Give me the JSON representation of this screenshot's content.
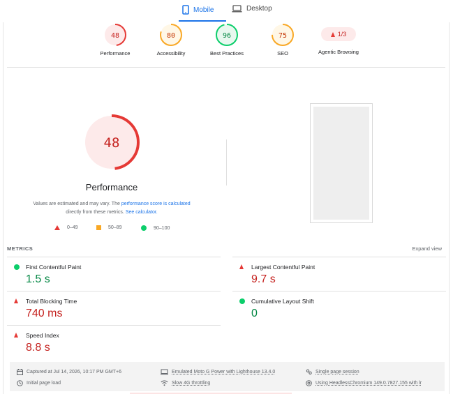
{
  "tabs": {
    "mobile": "Mobile",
    "desktop": "Desktop"
  },
  "summary": [
    {
      "score": "48",
      "label": "Performance",
      "status": "fail",
      "fraction": 0.48
    },
    {
      "score": "80",
      "label": "Accessibility",
      "status": "average",
      "fraction": 0.8
    },
    {
      "score": "96",
      "label": "Best Practices",
      "status": "pass",
      "fraction": 0.96
    },
    {
      "score": "75",
      "label": "SEO",
      "status": "average",
      "fraction": 0.75
    },
    {
      "score": "1/3",
      "label": "Agentic Browsing",
      "status": "fail"
    }
  ],
  "performance": {
    "score": "48",
    "fraction": 0.48,
    "title": "Performance",
    "disclaimer_a": "Values are estimated and may vary. The",
    "disclaimer_link1": "performance score is calculated",
    "disclaimer_b": "directly from these metrics.",
    "disclaimer_link2": "See calculator."
  },
  "legend": {
    "fail": "0–49",
    "average": "50–89",
    "pass": "90–100"
  },
  "metrics": {
    "title": "METRICS",
    "expand": "Expand view",
    "items": [
      {
        "label": "First Contentful Paint",
        "value": "1.5 s",
        "status": "pass"
      },
      {
        "label": "Largest Contentful Paint",
        "value": "9.7 s",
        "status": "fail"
      },
      {
        "label": "Total Blocking Time",
        "value": "740 ms",
        "status": "fail"
      },
      {
        "label": "Cumulative Layout Shift",
        "value": "0",
        "status": "pass"
      },
      {
        "label": "Speed Index",
        "value": "8.8 s",
        "status": "fail"
      }
    ]
  },
  "footer": {
    "captured": "Captured at Jul 14, 2026, 10:17 PM GMT+6",
    "initial": "Initial page load",
    "device": "Emulated Moto G Power with Lighthouse 13.4.0",
    "throttle": "Slow 4G throttling",
    "session": "Single page session",
    "browser": "Using HeadlessChromium 149.0.7827.155 with lr"
  },
  "colors": {
    "fail": "#e53935",
    "fail_text": "#c5221f",
    "average": "#f9a825",
    "average_text": "#c33300",
    "pass": "#0cce6b",
    "pass_text": "#018642",
    "accent": "#1a73e8"
  }
}
